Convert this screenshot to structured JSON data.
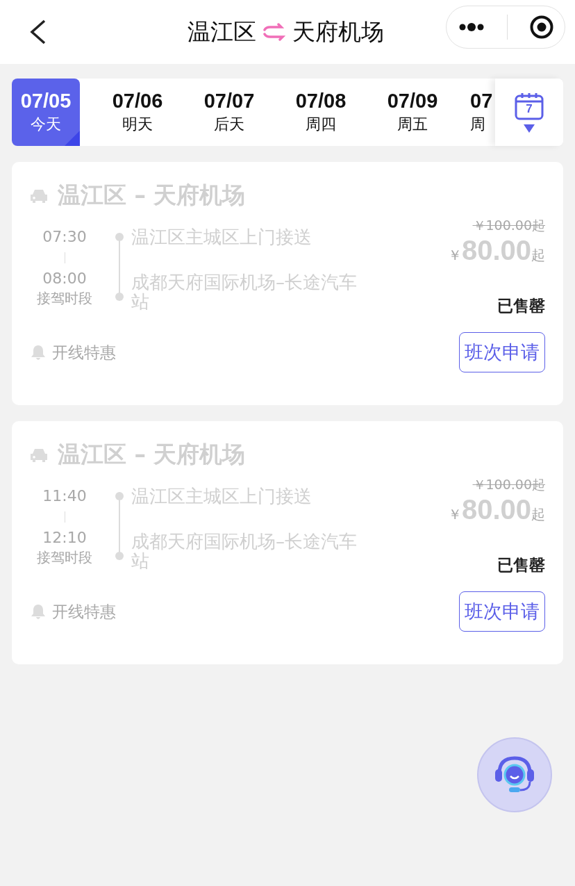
{
  "header": {
    "from": "温江区",
    "to": "天府机场"
  },
  "dates": [
    {
      "date": "07/05",
      "day": "今天",
      "selected": true
    },
    {
      "date": "07/06",
      "day": "明天",
      "selected": false
    },
    {
      "date": "07/07",
      "day": "后天",
      "selected": false
    },
    {
      "date": "07/08",
      "day": "周四",
      "selected": false
    },
    {
      "date": "07/09",
      "day": "周五",
      "selected": false
    },
    {
      "date": "07",
      "day": "周",
      "selected": false
    }
  ],
  "calendar_day": "7",
  "trips": [
    {
      "title": "温江区 – 天府机场",
      "start": "07:30",
      "end": "08:00",
      "time_label": "接驾时段",
      "pickup": "温江区主城区上门接送",
      "dropoff": "成都天府国际机场–长途汽车站",
      "old_price": "￥100.00起",
      "currency": "￥",
      "price": "80.00",
      "suffix": "起",
      "status": "已售罄",
      "sold_out": true,
      "promo": "开线特惠",
      "action": "班次申请"
    },
    {
      "title": "温江区 – 天府机场",
      "start": "11:40",
      "end": "12:10",
      "time_label": "接驾时段",
      "pickup": "温江区主城区上门接送",
      "dropoff": "成都天府国际机场–长途汽车站",
      "old_price": "￥100.00起",
      "currency": "￥",
      "price": "80.00",
      "suffix": "起",
      "status": "已售罄",
      "sold_out": true,
      "promo": "开线特惠",
      "action": "班次申请"
    }
  ]
}
